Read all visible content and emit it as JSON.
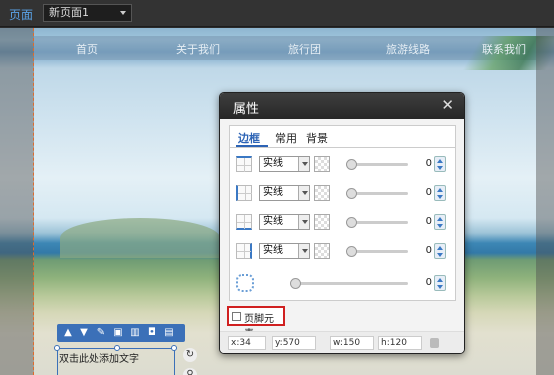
{
  "topbar": {
    "page_label": "页面",
    "page_select": "新页面1"
  },
  "nav": [
    "首页",
    "关于我们",
    "旅行团",
    "旅游线路",
    "联系我们"
  ],
  "element_toolbar": {
    "icons": [
      "up-arrow-icon",
      "down-arrow-icon",
      "edit-icon",
      "image-icon",
      "chart-icon",
      "lock-icon",
      "delete-icon"
    ]
  },
  "textbox": {
    "placeholder_text": "双击此处添加文字"
  },
  "dialog": {
    "title": "属性",
    "close_glyph": "✕",
    "tabs": [
      "边框",
      "常用",
      "背景"
    ],
    "border_rows": [
      {
        "style": "实线",
        "value": "0"
      },
      {
        "style": "实线",
        "value": "0"
      },
      {
        "style": "实线",
        "value": "0"
      },
      {
        "style": "实线",
        "value": "0"
      }
    ],
    "radius_value": "0",
    "footer_checkbox_label": "页脚元素",
    "footer_checked": false,
    "coords": {
      "x": "x:34",
      "y": "y:570",
      "w": "w:150",
      "h": "h:120"
    }
  },
  "colors": {
    "accent": "#2c63b5",
    "highlight_red": "#d02020",
    "guide_orange": "#e06a2a"
  }
}
